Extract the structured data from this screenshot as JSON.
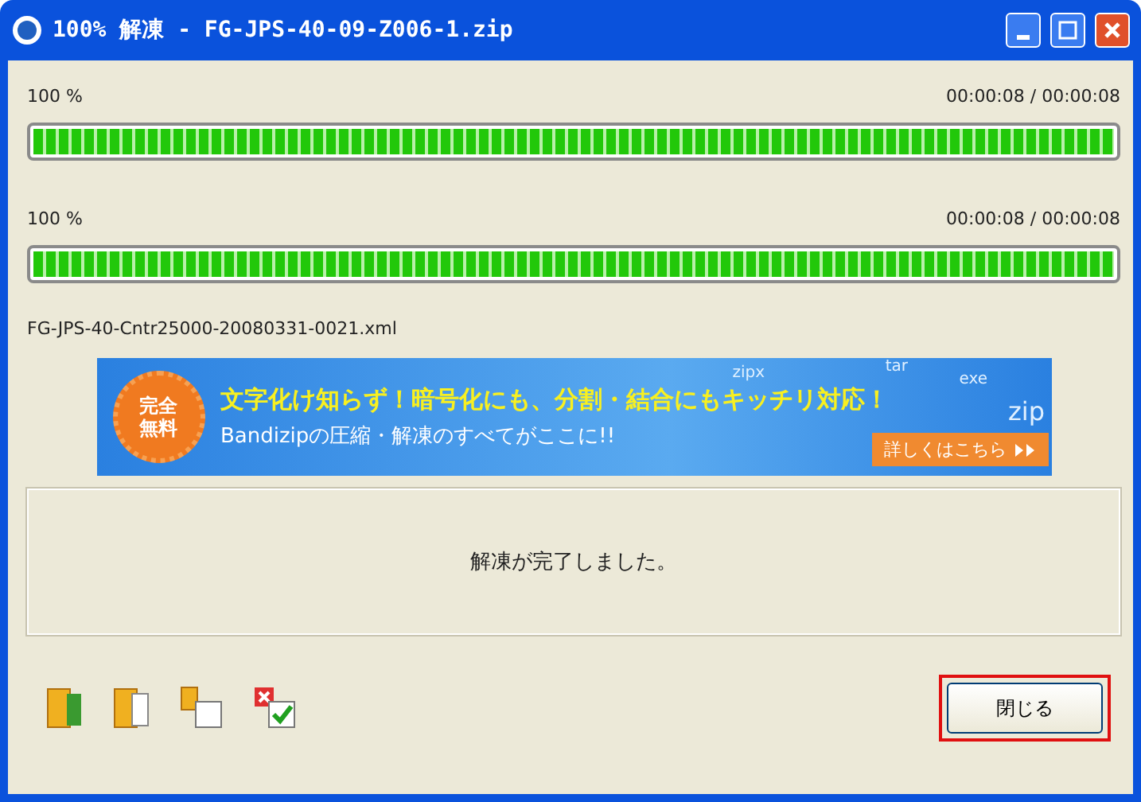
{
  "window": {
    "title": "100% 解凍 - FG-JPS-40-09-Z006-1.zip"
  },
  "progress": [
    {
      "percent": "100 %",
      "time": "00:00:08 / 00:00:08",
      "level": 1
    },
    {
      "percent": "100 %",
      "time": "00:00:08 / 00:00:08",
      "level": 1
    }
  ],
  "current_file": "FG-JPS-40-Cntr25000-20080331-0021.xml",
  "banner": {
    "badge": [
      "完全",
      "無料"
    ],
    "headline": "文字化け知らず！暗号化にも、分割・結合にもキッチリ対応！",
    "subline": "Bandizipの圧縮・解凍のすべてがここに!!",
    "link": "詳しくはこちら",
    "formats": [
      "zipx",
      "tar",
      "exe",
      "zip"
    ]
  },
  "message": "解凍が完了しました。",
  "toolbar": [
    {
      "kind": "open-folder"
    },
    {
      "kind": "folder"
    },
    {
      "kind": "copy"
    },
    {
      "kind": "check"
    }
  ],
  "close_button": {
    "label": "閉じる",
    "highlighted": true
  }
}
